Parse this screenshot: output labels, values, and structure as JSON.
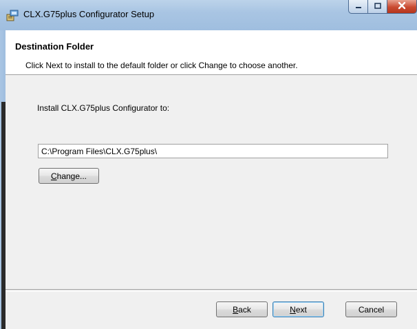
{
  "window": {
    "title": "CLX.G75plus Configurator Setup"
  },
  "header": {
    "title": "Destination Folder",
    "description": "Click Next to install to the default folder or click Change to choose another."
  },
  "main": {
    "install_label": "Install CLX.G75plus Configurator to:",
    "path_value": "C:\\Program Files\\CLX.G75plus\\",
    "change_label_accel": "C",
    "change_label_rest": "hange..."
  },
  "footer": {
    "back_accel": "B",
    "back_rest": "ack",
    "next_accel": "N",
    "next_rest": "ext",
    "cancel_label": "Cancel"
  },
  "colors": {
    "titlebar": "#a9c5e3",
    "close_button": "#c94a30",
    "body_background": "#f0f0f0"
  },
  "icons": [
    "installer-app-icon",
    "minimize-icon",
    "maximize-icon",
    "close-icon"
  ]
}
